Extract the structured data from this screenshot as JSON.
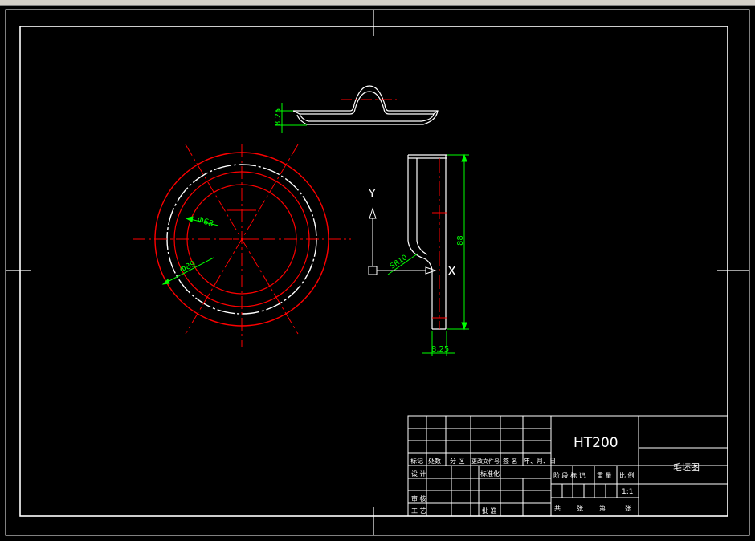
{
  "app": {
    "type": "cad-viewport",
    "background": "#000000",
    "ui_strip_color": "#d4d0c8"
  },
  "colors": {
    "geometry": "#ffffff",
    "centerline": "#ff0000",
    "dimension": "#00ff00",
    "frame": "#ffffff"
  },
  "drawing": {
    "dims": {
      "top_height": "8.25",
      "inner_dia": "Φ68",
      "outer_dia": "Φ89",
      "radius": "SR10",
      "profile_height": "88",
      "bottom_thickness": "8.25"
    },
    "ucs": {
      "y_label": "Y",
      "x_label": "X"
    }
  },
  "title_block": {
    "material": "HT200",
    "part_name": "毛坯图",
    "scale_value": "1:1",
    "header_cells": [
      "标记",
      "处数",
      "分 区",
      "更改文件号",
      "签 名",
      "年、月、日"
    ],
    "rows": {
      "design": "设 计",
      "standardize": "标准化",
      "review": "审 核",
      "process": "工 艺",
      "approve": "批 准"
    },
    "stage_headers": [
      "阶 段 标 记",
      "重 量",
      "比 例"
    ],
    "sheet_info": [
      "共",
      "张",
      "第",
      "张"
    ]
  }
}
